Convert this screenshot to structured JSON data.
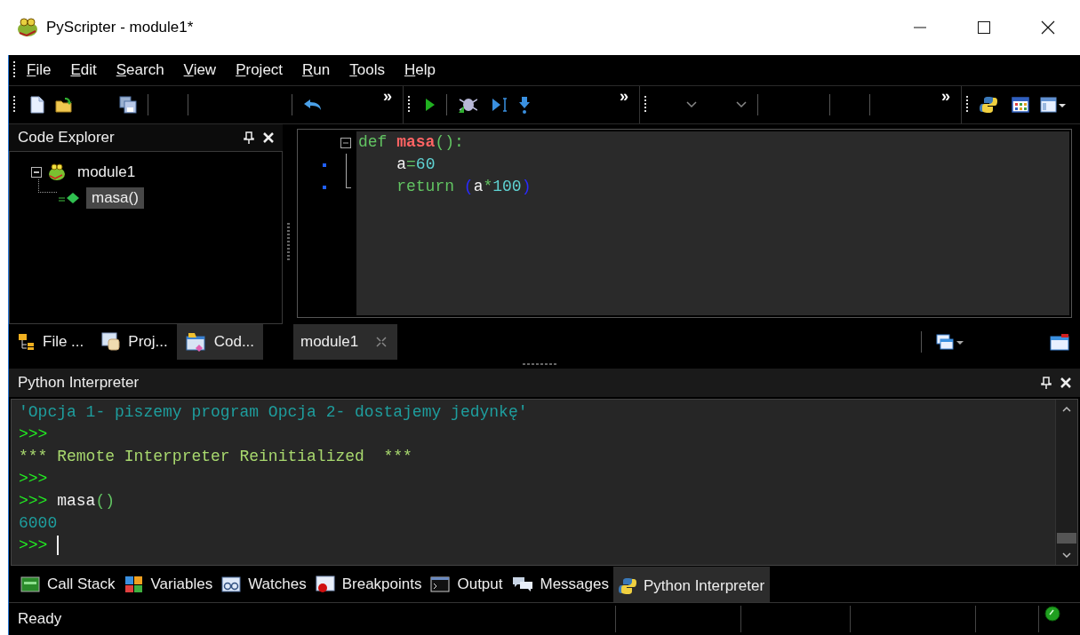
{
  "window": {
    "title": "PyScripter - module1*"
  },
  "menu": [
    "File",
    "Edit",
    "Search",
    "View",
    "Project",
    "Run",
    "Tools",
    "Help"
  ],
  "toolbar": {
    "overflow_marks": [
      "»",
      "»",
      "»"
    ]
  },
  "code_explorer": {
    "title": "Code Explorer",
    "tree": [
      {
        "label": "module1",
        "expanded": true,
        "selected": false,
        "children": [
          {
            "label": "masa()",
            "selected": true
          }
        ]
      }
    ],
    "tabs": [
      {
        "label": "File ...",
        "selected": false
      },
      {
        "label": "Proj...",
        "selected": false
      },
      {
        "label": "Cod...",
        "selected": true
      }
    ]
  },
  "editor": {
    "lines": [
      {
        "kind": "head",
        "marker": false,
        "tokens": [
          {
            "kind": "keyword",
            "text": "def "
          },
          {
            "kind": "function",
            "text": "masa"
          },
          {
            "kind": "operator",
            "text": "():"
          }
        ]
      },
      {
        "kind": "body",
        "marker": true,
        "tokens": [
          {
            "kind": "identifier",
            "text": "    a"
          },
          {
            "kind": "operator",
            "text": "="
          },
          {
            "kind": "number",
            "text": "60"
          }
        ]
      },
      {
        "kind": "tail",
        "marker": true,
        "tokens": [
          {
            "kind": "keyword",
            "text": "    return "
          },
          {
            "kind": "bracket",
            "text": "("
          },
          {
            "kind": "identifier",
            "text": "a"
          },
          {
            "kind": "operator",
            "text": "*"
          },
          {
            "kind": "number",
            "text": "100"
          },
          {
            "kind": "bracket",
            "text": ")"
          }
        ]
      }
    ],
    "tabs": [
      {
        "label": "module1",
        "selected": true
      }
    ]
  },
  "interpreter": {
    "title": "Python Interpreter",
    "lines": [
      {
        "cursor": false,
        "tokens": [
          {
            "kind": "string",
            "text": "'Opcja 1- piszemy program Opcja 2- dostajemy jedynkę'"
          }
        ]
      },
      {
        "cursor": false,
        "tokens": [
          {
            "kind": "prompt",
            "text": ">>>"
          }
        ]
      },
      {
        "cursor": false,
        "tokens": [
          {
            "kind": "message",
            "text": "*** Remote Interpreter Reinitialized  ***"
          }
        ]
      },
      {
        "cursor": false,
        "tokens": [
          {
            "kind": "prompt",
            "text": ">>>"
          }
        ]
      },
      {
        "cursor": false,
        "tokens": [
          {
            "kind": "prompt",
            "text": ">>> "
          },
          {
            "kind": "identifier",
            "text": "masa"
          },
          {
            "kind": "operator",
            "text": "()"
          }
        ]
      },
      {
        "cursor": false,
        "tokens": [
          {
            "kind": "output",
            "text": "6000"
          }
        ]
      },
      {
        "cursor": true,
        "tokens": [
          {
            "kind": "prompt",
            "text": ">>> "
          }
        ]
      }
    ]
  },
  "bottom_tabs": [
    {
      "label": "Call Stack",
      "selected": false
    },
    {
      "label": "Variables",
      "selected": false
    },
    {
      "label": "Watches",
      "selected": false
    },
    {
      "label": "Breakpoints",
      "selected": false
    },
    {
      "label": "Output",
      "selected": false
    },
    {
      "label": "Messages",
      "selected": false
    },
    {
      "label": "Python Interpreter",
      "selected": true
    }
  ],
  "status_bar": {
    "text": "Ready"
  }
}
